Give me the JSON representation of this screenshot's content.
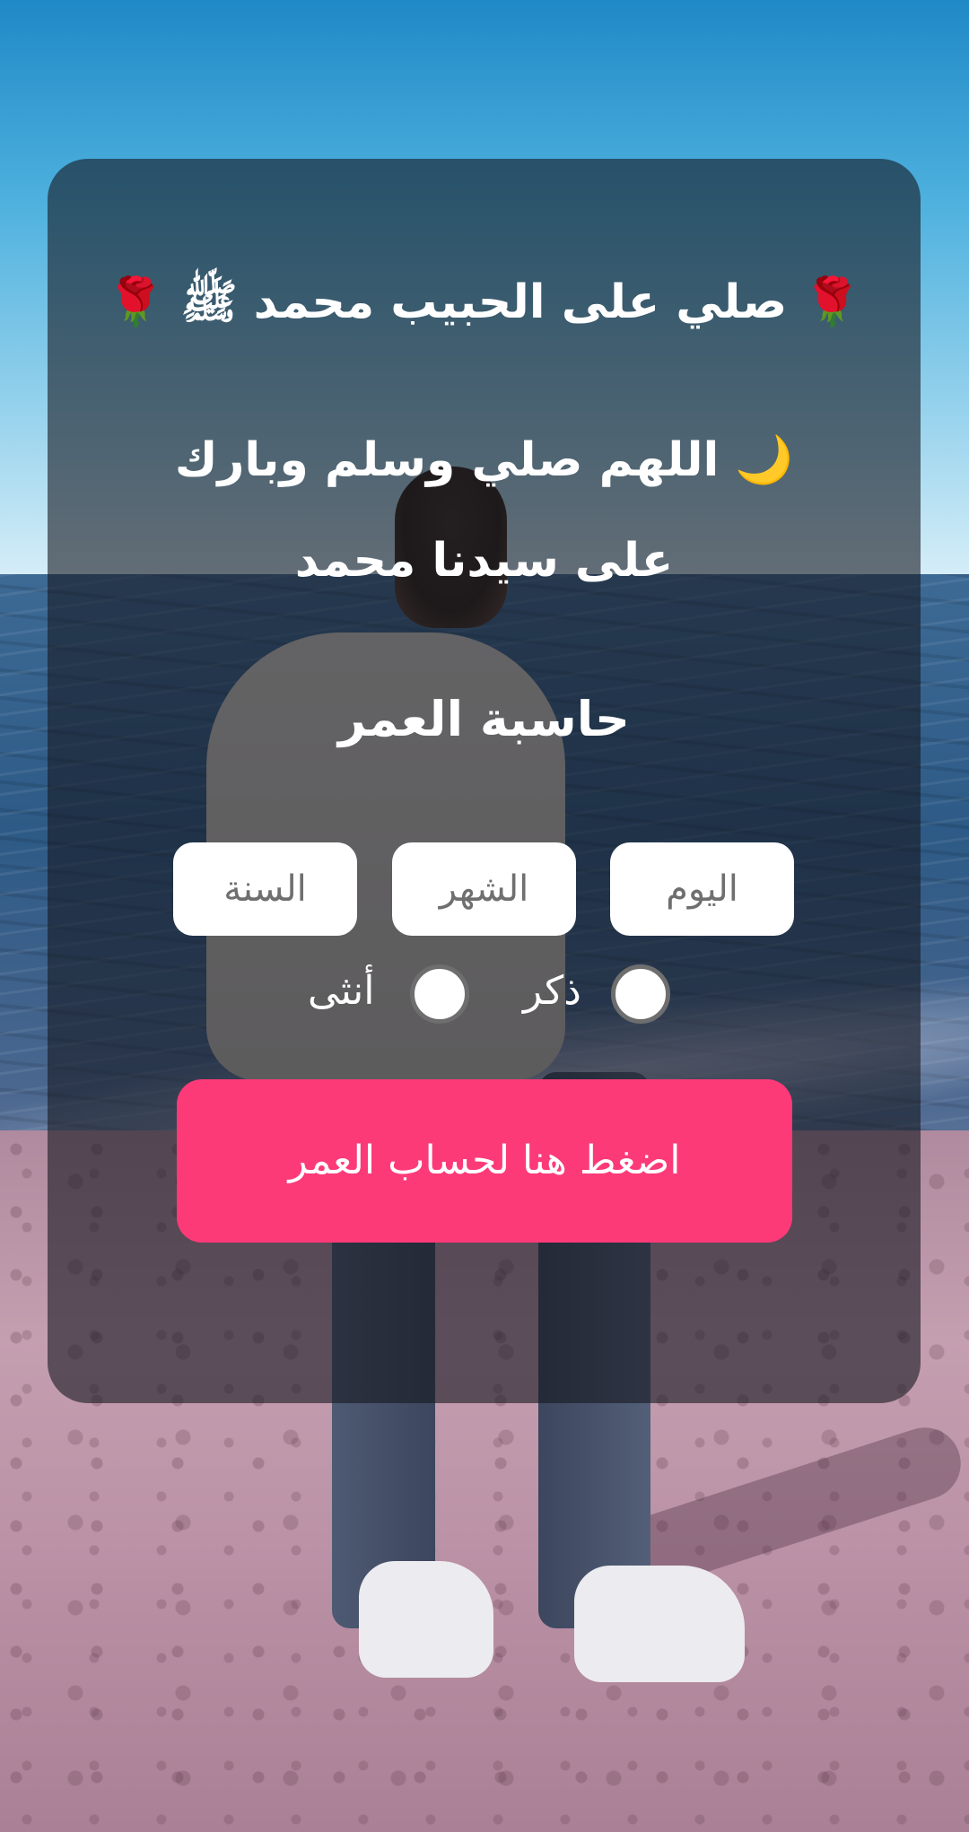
{
  "card": {
    "salawat_line": "🌹 صلي على الحبيب محمد ﷺ 🌹",
    "dua_line": "🌙 اللهم صلي وسلم وبارك على سيدنا محمد",
    "title": "حاسبة العمر"
  },
  "inputs": {
    "day_placeholder": "اليوم",
    "month_placeholder": "الشهر",
    "year_placeholder": "السنة"
  },
  "gender": {
    "male_label": "ذكر",
    "female_label": "أنثى"
  },
  "button": {
    "calculate_label": "اضغط هنا لحساب العمر"
  },
  "colors": {
    "button_accent": "#fd3a78",
    "card_overlay": "rgba(22,24,32,0.6)"
  }
}
